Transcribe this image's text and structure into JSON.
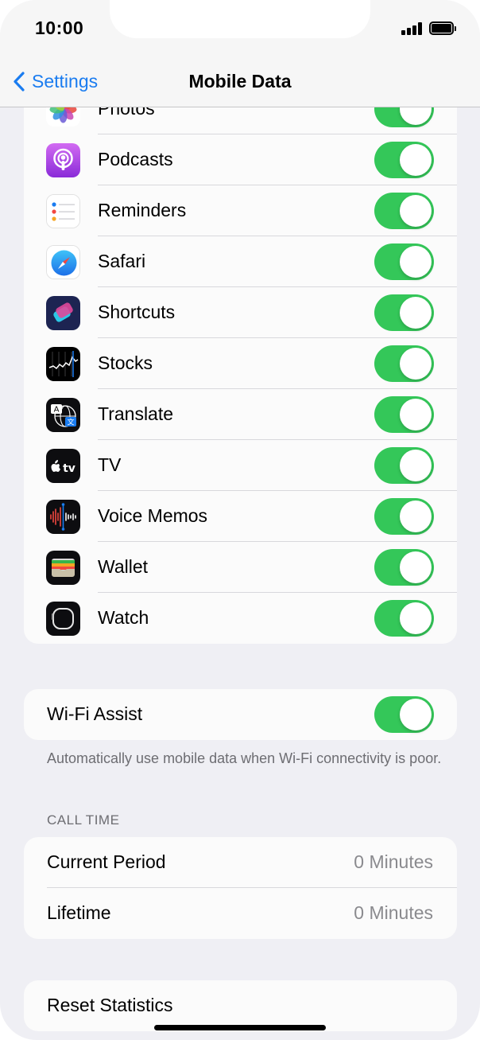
{
  "status_bar": {
    "time": "10:00"
  },
  "nav": {
    "back_label": "Settings",
    "title": "Mobile Data"
  },
  "apps": [
    {
      "name": "Photos",
      "icon": "photos-icon",
      "enabled": true
    },
    {
      "name": "Podcasts",
      "icon": "podcasts-icon",
      "enabled": true
    },
    {
      "name": "Reminders",
      "icon": "reminders-icon",
      "enabled": true
    },
    {
      "name": "Safari",
      "icon": "safari-icon",
      "enabled": true
    },
    {
      "name": "Shortcuts",
      "icon": "shortcuts-icon",
      "enabled": true
    },
    {
      "name": "Stocks",
      "icon": "stocks-icon",
      "enabled": true
    },
    {
      "name": "Translate",
      "icon": "translate-icon",
      "enabled": true
    },
    {
      "name": "TV",
      "icon": "tv-icon",
      "enabled": true
    },
    {
      "name": "Voice Memos",
      "icon": "voice-memos-icon",
      "enabled": true
    },
    {
      "name": "Wallet",
      "icon": "wallet-icon",
      "enabled": true
    },
    {
      "name": "Watch",
      "icon": "watch-icon",
      "enabled": true
    }
  ],
  "wifi_assist": {
    "label": "Wi-Fi Assist",
    "enabled": true,
    "footnote": "Automatically use mobile data when Wi-Fi connectivity is poor."
  },
  "call_time": {
    "header": "CALL TIME",
    "rows": [
      {
        "label": "Current Period",
        "value": "0 Minutes"
      },
      {
        "label": "Lifetime",
        "value": "0 Minutes"
      }
    ]
  },
  "reset": {
    "label": "Reset Statistics"
  },
  "colors": {
    "accent": "#1a7cf0",
    "toggle_on": "#34c759",
    "background": "#efeff4"
  }
}
